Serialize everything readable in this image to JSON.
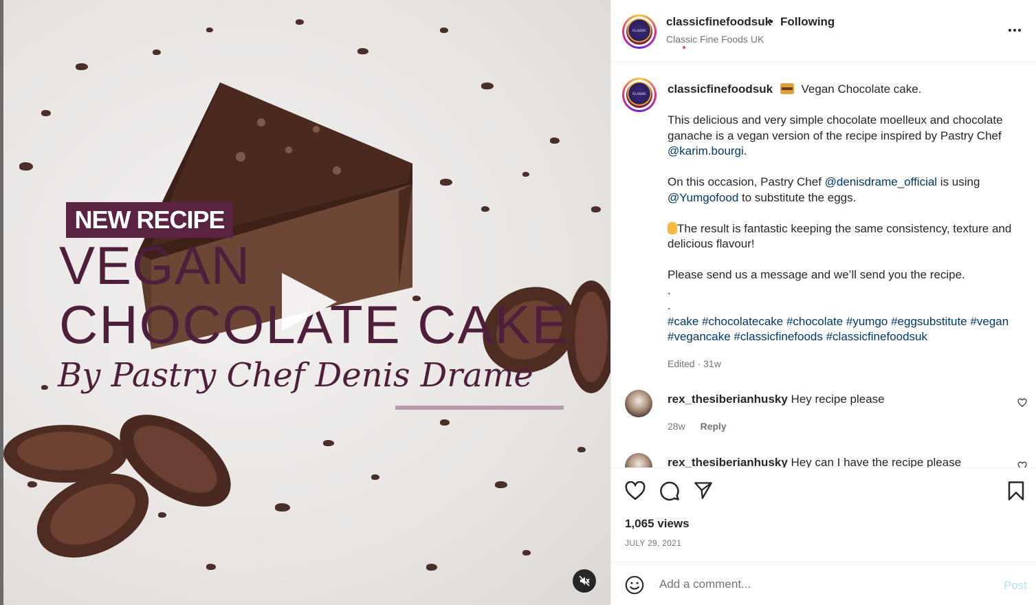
{
  "media": {
    "badge": "NEW RECIPE",
    "title_line1": "VEGAN",
    "title_line2": "CHOCOLATE CAKE",
    "byline": "By Pastry Chef Denis Drame"
  },
  "header": {
    "username": "classicfinefoodsuk",
    "separator": "•",
    "follow_status": "Following",
    "subtitle": "Classic Fine Foods UK"
  },
  "caption": {
    "username": "classicfinefoodsuk",
    "title": "Vegan Chocolate cake.",
    "p1_a": "This delicious and very simple chocolate moelleux and chocolate ganache is a vegan version of the recipe inspired by Pastry Chef ",
    "p1_link": "@karim.bourgi",
    "p1_b": ".",
    "p2_a": "On this occasion, Pastry Chef ",
    "p2_link1": "@denisdrame_official",
    "p2_b": " is using ",
    "p2_link2": "@Yumgofood",
    "p2_c": " to substitute the eggs.",
    "p3": "The result is fantastic keeping the same consistency, texture and delicious flavour!",
    "p4": "Please send us a message and we’ll send you the recipe.",
    "dot1": ".",
    "dot2": ".",
    "hashtags": "#cake #chocolatecake #chocolate #yumgo #eggsubstitute #vegan #vegancake #classicfinefoods #classicfinefoodsuk",
    "edited": "Edited · 31w"
  },
  "comments": [
    {
      "username": "rex_thesiberianhusky",
      "text": "Hey recipe please",
      "age": "28w",
      "reply": "Reply"
    },
    {
      "username": "rex_thesiberianhusky",
      "text": "Hey can I have the recipe please"
    }
  ],
  "footer": {
    "views": "1,065 views",
    "date": "JULY 29, 2021",
    "comment_placeholder": "Add a comment...",
    "post_label": "Post"
  },
  "colors": {
    "link": "#00376b",
    "muted": "#737373",
    "brand_purple": "#5a2342",
    "post_disabled": "#b2dffc"
  },
  "icons": [
    "play-icon",
    "mute-icon",
    "more-icon",
    "heart-icon",
    "comment-icon",
    "share-icon",
    "bookmark-icon",
    "emoji-icon"
  ]
}
